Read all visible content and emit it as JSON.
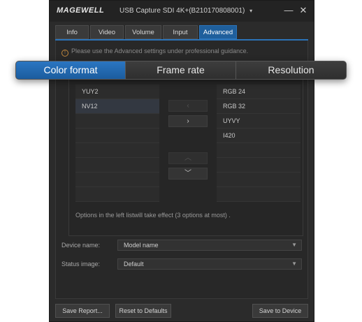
{
  "window": {
    "logo": "MAGEWELL",
    "title": "USB Capture SDI 4K+(B210170808001)",
    "title_caret": "▾",
    "minimize_glyph": "—",
    "close_glyph": "✕"
  },
  "tabs": [
    {
      "label": "Info",
      "active": false
    },
    {
      "label": "Video",
      "active": false
    },
    {
      "label": "Volume",
      "active": false
    },
    {
      "label": "Input",
      "active": false
    },
    {
      "label": "Advanced",
      "active": true
    }
  ],
  "notice": {
    "icon": "!",
    "text": "Please use the Advanced  settings under professional guidance."
  },
  "segmented": {
    "items": [
      {
        "label": "Color format",
        "active": true
      },
      {
        "label": "Frame rate",
        "active": false
      },
      {
        "label": "Resolution",
        "active": false
      }
    ]
  },
  "left_list": [
    "YUY2",
    "NV12",
    "",
    "",
    "",
    "",
    "",
    ""
  ],
  "right_list": [
    "RGB 24",
    "RGB 32",
    "UYVY",
    "I420",
    "",
    "",
    "",
    ""
  ],
  "arrows": {
    "move_left": "‹",
    "move_right": "›",
    "move_up": "︿",
    "move_down": "﹀"
  },
  "info_text": "Options in the left listwill take effect (3 options at most) .",
  "fields": {
    "device_name": {
      "label": "Device name:",
      "value": "Model name"
    },
    "status_image": {
      "label": "Status image:",
      "value": "Default"
    },
    "caret": "▼"
  },
  "buttons": {
    "save_report": "Save Report...",
    "reset_defaults": "Reset to Defaults",
    "save_device": "Save to Device"
  },
  "colors": {
    "accent": "#1f5f9c",
    "window_bg": "#2b2b2b",
    "notice_icon": "#c0873d"
  }
}
